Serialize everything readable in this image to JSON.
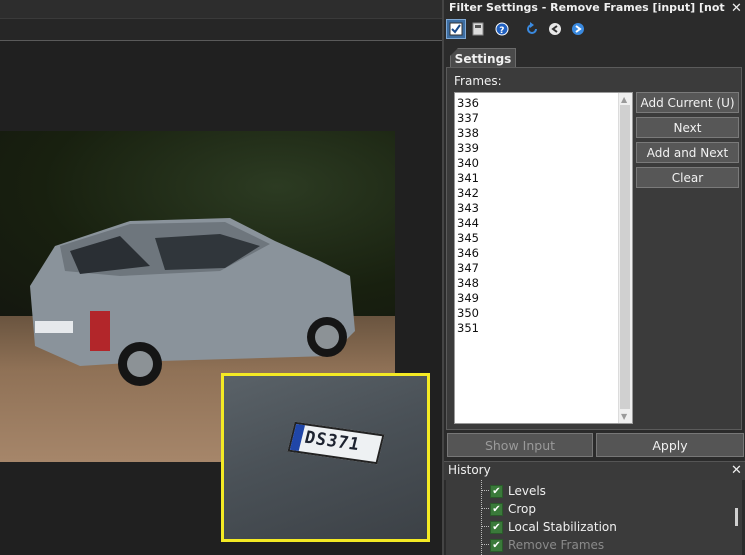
{
  "filter_panel": {
    "title": "Filter Settings - Remove Frames [input] [not confi...",
    "close_glyph": "✕",
    "toolbar_icons": [
      "checkbox-icon",
      "save-icon",
      "help-icon",
      "undo-icon",
      "back-icon",
      "forward-icon"
    ],
    "tab_label": "Settings",
    "frames_label": "Frames:",
    "frames": [
      "336",
      "337",
      "338",
      "339",
      "340",
      "341",
      "342",
      "343",
      "344",
      "345",
      "346",
      "347",
      "348",
      "349",
      "350",
      "351"
    ],
    "buttons": {
      "add_current": "Add Current (U)",
      "next": "Next",
      "add_and_next": "Add and Next",
      "clear": "Clear"
    },
    "show_input": "Show Input",
    "apply": "Apply"
  },
  "history": {
    "title": "History",
    "close_glyph": "✕",
    "items": [
      {
        "label": "Levels",
        "checked": true
      },
      {
        "label": "Crop",
        "checked": true
      },
      {
        "label": "Local Stabilization",
        "checked": true
      },
      {
        "label": "Remove Frames",
        "checked": true
      }
    ]
  },
  "video": {
    "plate_text": "DS371"
  },
  "colors": {
    "highlight": "#f4ea24",
    "panel_bg": "#2b2b2b",
    "button_bg": "#575757"
  }
}
